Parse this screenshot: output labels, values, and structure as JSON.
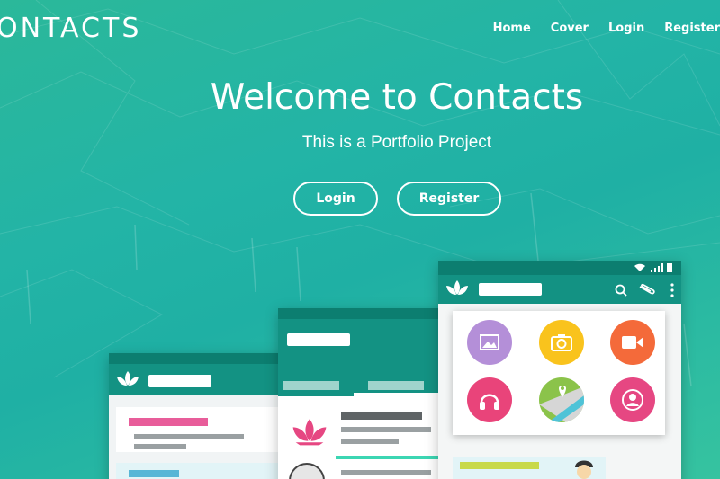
{
  "brand": "ONTACTS",
  "nav": {
    "items": [
      "Home",
      "Cover",
      "Login",
      "Register"
    ]
  },
  "hero": {
    "title": "Welcome to Contacts",
    "subtitle": "This is a Portfolio Project",
    "login_label": "Login",
    "register_label": "Register"
  },
  "colors": {
    "bg_gradient": [
      "#2bb89a",
      "#1fb0a4",
      "#36c3a0"
    ],
    "phone_header": "#139283",
    "phone_statusbar": "#0c7e70",
    "icon_purple": "#b48fd8",
    "icon_yellow": "#f9c31d",
    "icon_orange": "#f46a3a",
    "icon_pink": "#e9447a",
    "icon_pink2": "#e64782"
  },
  "icons": [
    "lotus-icon",
    "search-icon",
    "paperclip-icon",
    "more-vert-icon",
    "wifi-icon",
    "signal-icon",
    "battery-icon",
    "image-icon",
    "camera-icon",
    "video-icon",
    "headphones-icon",
    "map-icon",
    "person-icon"
  ]
}
